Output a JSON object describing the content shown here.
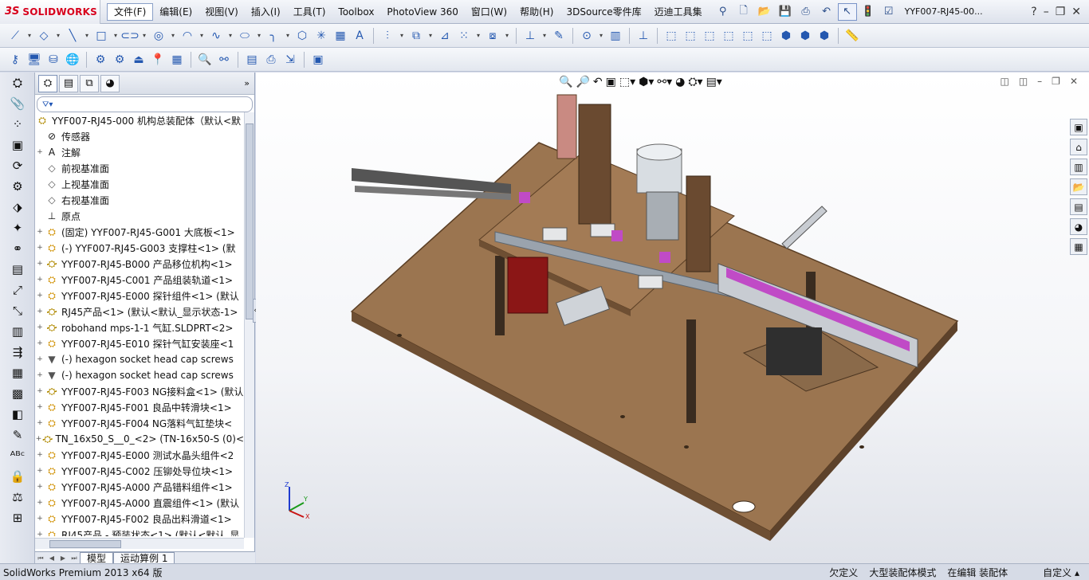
{
  "app": {
    "logo_text": "SOLIDWORKS",
    "logo_mark": "3S",
    "doc_title": "YYF007-RJ45-00..."
  },
  "menu": [
    "文件(F)",
    "编辑(E)",
    "视图(V)",
    "插入(I)",
    "工具(T)",
    "Toolbox",
    "PhotoView 360",
    "窗口(W)",
    "帮助(H)",
    "3DSource零件库",
    "迈迪工具集"
  ],
  "tree": {
    "filter_icon": "funnel-icon",
    "root": "YYF007-RJ45-000  机构总装配体（默认<默",
    "items": [
      {
        "label": "传感器",
        "icon": "sensor",
        "expand": ""
      },
      {
        "label": "注解",
        "icon": "annotation",
        "expand": "+"
      },
      {
        "label": "前视基准面",
        "icon": "plane",
        "expand": ""
      },
      {
        "label": "上视基准面",
        "icon": "plane",
        "expand": ""
      },
      {
        "label": "右视基准面",
        "icon": "plane",
        "expand": ""
      },
      {
        "label": "原点",
        "icon": "origin",
        "expand": ""
      },
      {
        "label": "(固定) YYF007-RJ45-G001  大底板<1>",
        "icon": "part",
        "expand": "+"
      },
      {
        "label": "(-) YYF007-RJ45-G003  支撑柱<1> (默",
        "icon": "part",
        "expand": "+"
      },
      {
        "label": "YYF007-RJ45-B000  产品移位机构<1>",
        "icon": "asm",
        "expand": "+"
      },
      {
        "label": "YYF007-RJ45-C001  产品组装轨道<1>",
        "icon": "part",
        "expand": "+"
      },
      {
        "label": "YYF007-RJ45-E000  探针组件<1> (默认",
        "icon": "part",
        "expand": "+"
      },
      {
        "label": "RJ45产品<1> (默认<默认_显示状态-1>",
        "icon": "asm",
        "expand": "+"
      },
      {
        "label": "robohand mps-1-1 气缸.SLDPRT<2>",
        "icon": "asm",
        "expand": "+"
      },
      {
        "label": "YYF007-RJ45-E010  探针气缸安装座<1",
        "icon": "part",
        "expand": "+"
      },
      {
        "label": "(-) hexagon socket head cap screws",
        "icon": "screw",
        "expand": "+"
      },
      {
        "label": "(-) hexagon socket head cap screws",
        "icon": "screw",
        "expand": "+"
      },
      {
        "label": "YYF007-RJ45-F003 NG接料盒<1> (默认",
        "icon": "asm",
        "expand": "+"
      },
      {
        "label": "YYF007-RJ45-F001  良品中转滑块<1>",
        "icon": "part",
        "expand": "+"
      },
      {
        "label": "YYF007-RJ45-F004  NG落料气缸垫块<",
        "icon": "part",
        "expand": "+"
      },
      {
        "label": "TN_16x50_S__0_<2> (TN-16x50-S (0)<",
        "icon": "asm",
        "expand": "+"
      },
      {
        "label": "YYF007-RJ45-E000  测试水晶头组件<2",
        "icon": "part",
        "expand": "+"
      },
      {
        "label": "YYF007-RJ45-C002  压铆处导位块<1>",
        "icon": "part",
        "expand": "+"
      },
      {
        "label": "YYF007-RJ45-A000  产品错料组件<1>",
        "icon": "part",
        "expand": "+"
      },
      {
        "label": "YYF007-RJ45-A000  直震组件<1> (默认",
        "icon": "part",
        "expand": "+"
      },
      {
        "label": "YYF007-RJ45-F002  良品出料滑道<1>",
        "icon": "part",
        "expand": "+"
      },
      {
        "label": "RJ45产品 - 预装状态<1> (默认<默认_显",
        "icon": "part",
        "expand": "+"
      }
    ]
  },
  "tabs": {
    "model": "模型",
    "motion": "运动算例 1"
  },
  "status": {
    "product": "SolidWorks Premium 2013 x64 版",
    "s1": "欠定义",
    "s2": "大型装配体模式",
    "s3": "在编辑 装配体",
    "s4": "自定义 ▴"
  },
  "triad": {
    "x": "X",
    "y": "Y",
    "z": "Z"
  }
}
